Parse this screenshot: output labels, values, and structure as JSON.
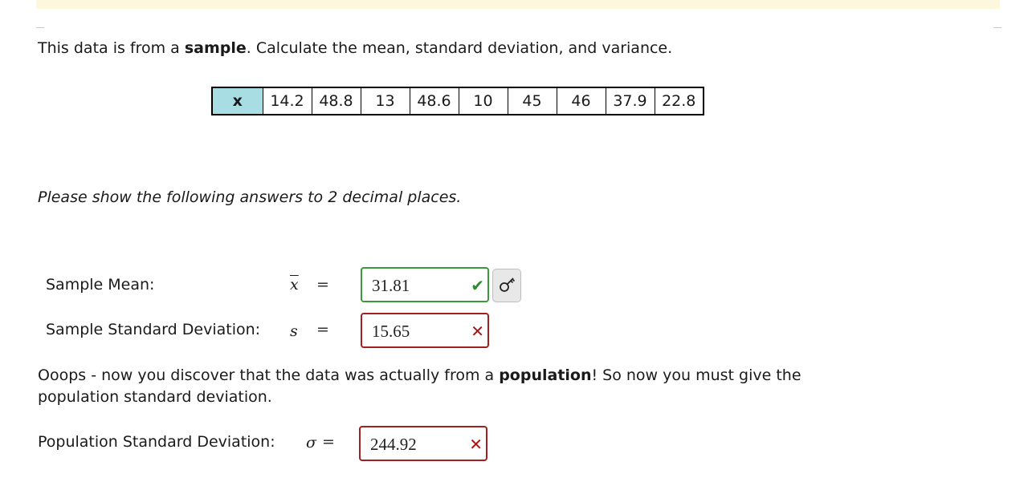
{
  "question": {
    "prefix": "This data is from a ",
    "bold": "sample",
    "suffix": ". Calculate the mean, standard deviation, and variance."
  },
  "table": {
    "header": "x",
    "values": [
      "14.2",
      "48.8",
      "13",
      "48.6",
      "10",
      "45",
      "46",
      "37.9",
      "22.8"
    ]
  },
  "instruction": "Please show the following answers to 2 decimal places.",
  "sample_mean": {
    "label": "Sample Mean:",
    "symbol": "x",
    "equals": "=",
    "value": "31.81",
    "status": "correct",
    "status_icon": "check-icon"
  },
  "sample_sd": {
    "label": "Sample Standard Deviation:",
    "symbol": "s",
    "equals": "=",
    "value": "15.65",
    "status": "incorrect",
    "status_icon": "cross-icon"
  },
  "note": {
    "prefix": "Ooops - now you discover that the data was actually from a ",
    "bold": "population",
    "suffix": "! So now you must give the population standard deviation."
  },
  "population_sd": {
    "label": "Population Standard Deviation:",
    "symbol": "σ",
    "equals": "=",
    "value": "244.92",
    "status": "incorrect",
    "status_icon": "cross-icon"
  },
  "key_button_icon": "key-icon",
  "colors": {
    "banner": "#fdf7dd",
    "table_header_bg": "#a9dde4",
    "correct": "#3a9a3a",
    "incorrect": "#a32020"
  }
}
